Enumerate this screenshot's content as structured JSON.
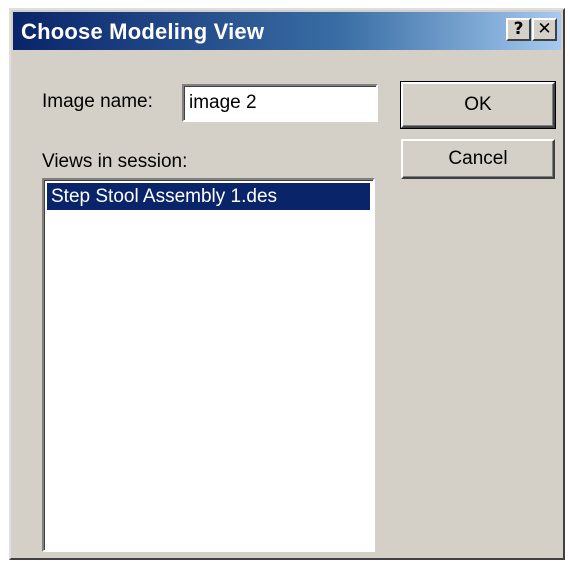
{
  "window": {
    "title": "Choose Modeling View",
    "help_glyph": "?",
    "close_glyph": "✕"
  },
  "form": {
    "image_name_label": "Image name:",
    "image_name_value": "image 2",
    "views_label": "Views in session:"
  },
  "views_list": {
    "items": [
      {
        "label": "Step Stool Assembly 1.des",
        "selected": true
      }
    ]
  },
  "buttons": {
    "ok_label": "OK",
    "cancel_label": "Cancel"
  },
  "colors": {
    "titlebar_start": "#0a246a",
    "titlebar_end": "#a6caf0",
    "dialog_face": "#d4d0c8",
    "selection": "#0a246a"
  }
}
